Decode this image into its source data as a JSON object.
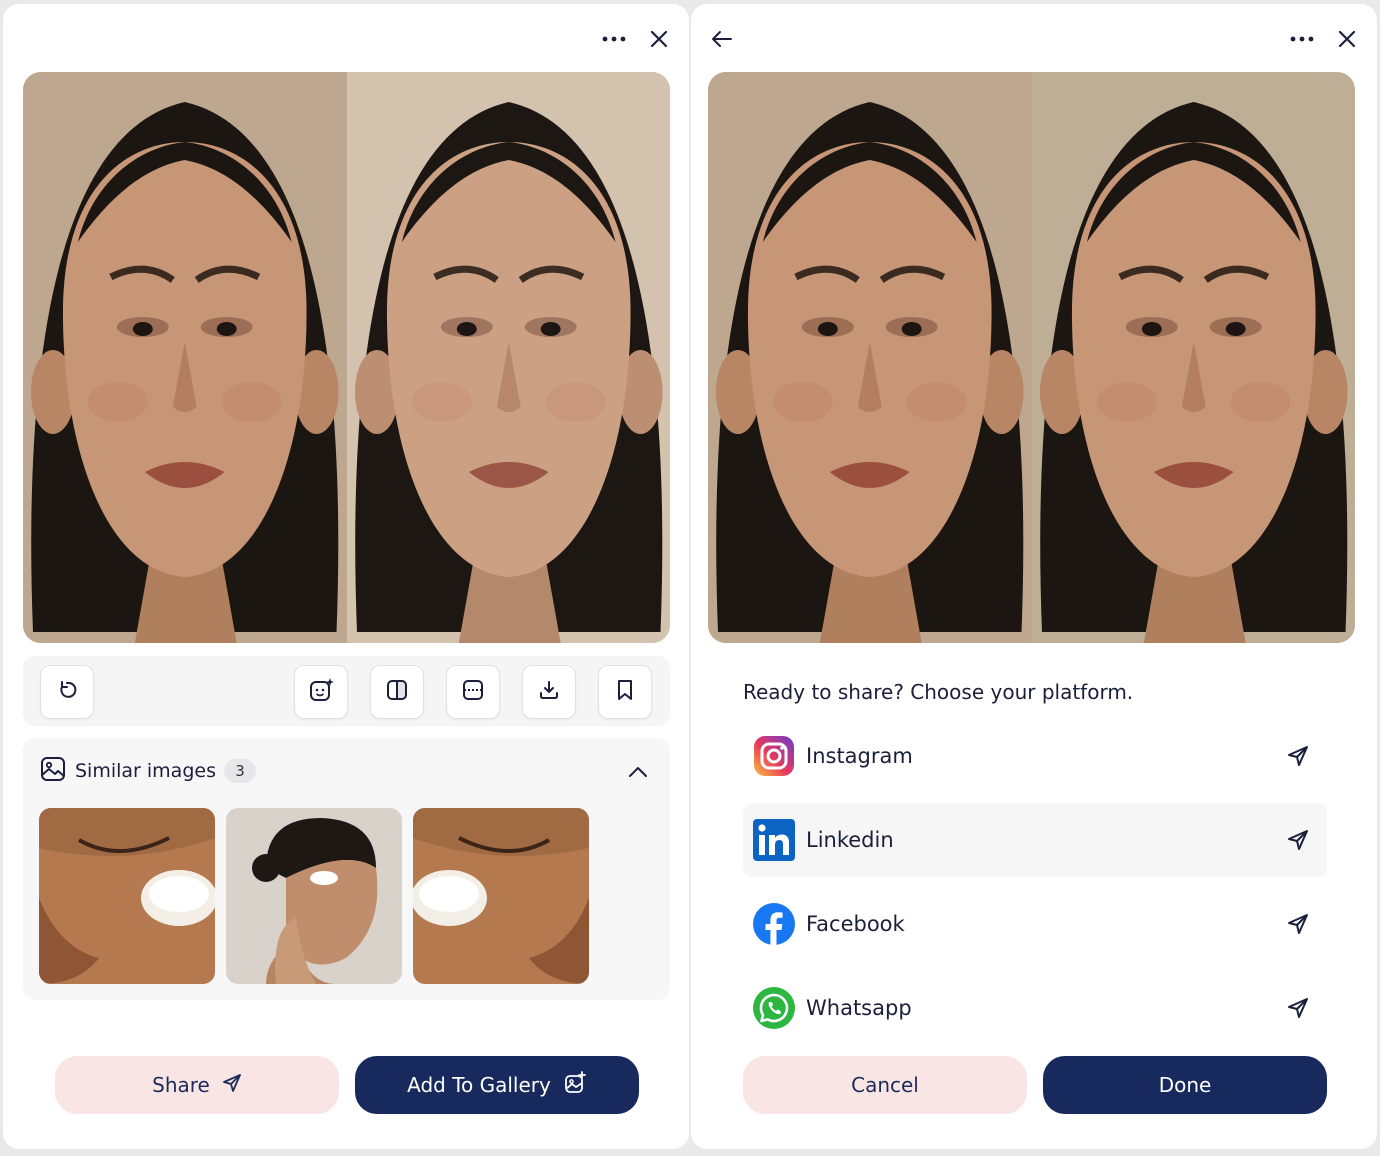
{
  "left_panel": {
    "more_icon": "more-horizontal-icon",
    "close_icon": "close-icon",
    "toolbar": {
      "icons": [
        "rotate-icon",
        "face-sparkle-icon",
        "split-vertical-icon",
        "split-horizontal-icon",
        "download-icon",
        "bookmark-icon"
      ]
    },
    "similar": {
      "title": "Similar images",
      "count": "3"
    },
    "share_label": "Share",
    "gallery_label": "Add To Gallery"
  },
  "right_panel": {
    "back_icon": "arrow-left-icon",
    "prompt": "Ready to share? Choose your platform.",
    "platforms": [
      {
        "name": "Instagram",
        "icon": "instagram-icon"
      },
      {
        "name": "Linkedin",
        "icon": "linkedin-icon"
      },
      {
        "name": "Facebook",
        "icon": "facebook-icon"
      },
      {
        "name": "Whatsapp",
        "icon": "whatsapp-icon"
      }
    ],
    "cancel_label": "Cancel",
    "done_label": "Done"
  },
  "colors": {
    "primary": "#18295d",
    "secondary_bg": "#f9e6e4",
    "panel_bg": "#ffffff",
    "app_bg": "#e9e9ec"
  }
}
